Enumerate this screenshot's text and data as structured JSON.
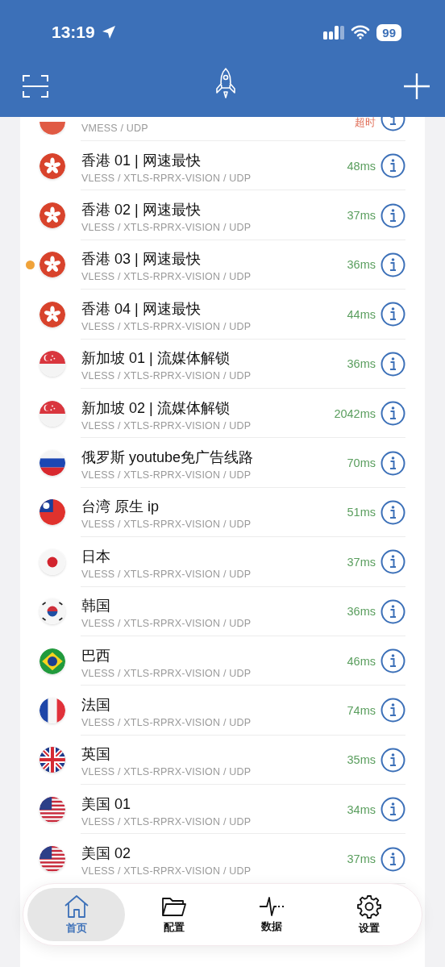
{
  "status_bar": {
    "time": "13:19",
    "battery": "99"
  },
  "partial_server": {
    "kind": "red",
    "protocol": "VMESS / UDP",
    "latency": "超时",
    "color": "#e0705a"
  },
  "servers": [
    {
      "kind": "hk",
      "name": "香港 01 |  网速最快",
      "protocol": "VLESS / XTLS-RPRX-VISION / UDP",
      "latency": "48ms",
      "color": "#5a9e5e",
      "selected": false
    },
    {
      "kind": "hk",
      "name": "香港 02 |  网速最快",
      "protocol": "VLESS / XTLS-RPRX-VISION / UDP",
      "latency": "37ms",
      "color": "#5a9e5e",
      "selected": false
    },
    {
      "kind": "hk",
      "name": "香港 03 |  网速最快",
      "protocol": "VLESS / XTLS-RPRX-VISION / UDP",
      "latency": "36ms",
      "color": "#5a9e5e",
      "selected": true
    },
    {
      "kind": "hk",
      "name": "香港 04 |  网速最快",
      "protocol": "VLESS / XTLS-RPRX-VISION / UDP",
      "latency": "44ms",
      "color": "#5a9e5e",
      "selected": false
    },
    {
      "kind": "sg",
      "name": "新加坡 01 | 流媒体解锁",
      "protocol": "VLESS / XTLS-RPRX-VISION / UDP",
      "latency": "36ms",
      "color": "#5a9e5e",
      "selected": false
    },
    {
      "kind": "sg",
      "name": "新加坡 02 | 流媒体解锁",
      "protocol": "VLESS / XTLS-RPRX-VISION / UDP",
      "latency": "2042ms",
      "color": "#5a9e5e",
      "selected": false
    },
    {
      "kind": "ru",
      "name": "俄罗斯 youtube免广告线路",
      "protocol": "VLESS / XTLS-RPRX-VISION / UDP",
      "latency": "70ms",
      "color": "#5a9e5e",
      "selected": false
    },
    {
      "kind": "tw",
      "name": "台湾 原生 ip",
      "protocol": "VLESS / XTLS-RPRX-VISION / UDP",
      "latency": "51ms",
      "color": "#5a9e5e",
      "selected": false
    },
    {
      "kind": "jp",
      "name": "日本",
      "protocol": "VLESS / XTLS-RPRX-VISION / UDP",
      "latency": "37ms",
      "color": "#5a9e5e",
      "selected": false
    },
    {
      "kind": "kr",
      "name": "韩国",
      "protocol": "VLESS / XTLS-RPRX-VISION / UDP",
      "latency": "36ms",
      "color": "#5a9e5e",
      "selected": false
    },
    {
      "kind": "br",
      "name": "巴西",
      "protocol": "VLESS / XTLS-RPRX-VISION / UDP",
      "latency": "46ms",
      "color": "#5a9e5e",
      "selected": false
    },
    {
      "kind": "fr",
      "name": "法国",
      "protocol": "VLESS / XTLS-RPRX-VISION / UDP",
      "latency": "74ms",
      "color": "#5a9e5e",
      "selected": false
    },
    {
      "kind": "gb",
      "name": "英国",
      "protocol": "VLESS / XTLS-RPRX-VISION / UDP",
      "latency": "35ms",
      "color": "#5a9e5e",
      "selected": false
    },
    {
      "kind": "us",
      "name": "美国 01",
      "protocol": "VLESS / XTLS-RPRX-VISION / UDP",
      "latency": "34ms",
      "color": "#5a9e5e",
      "selected": false
    },
    {
      "kind": "us",
      "name": "美国 02",
      "protocol": "VLESS / XTLS-RPRX-VISION / UDP",
      "latency": "37ms",
      "color": "#5a9e5e",
      "selected": false
    }
  ],
  "tabs": [
    {
      "kind": "home",
      "label": "首页",
      "selected": true
    },
    {
      "kind": "folder",
      "label": "配置",
      "selected": false
    },
    {
      "kind": "pulse",
      "label": "数据",
      "selected": false
    },
    {
      "kind": "gear",
      "label": "设置",
      "selected": false
    }
  ]
}
